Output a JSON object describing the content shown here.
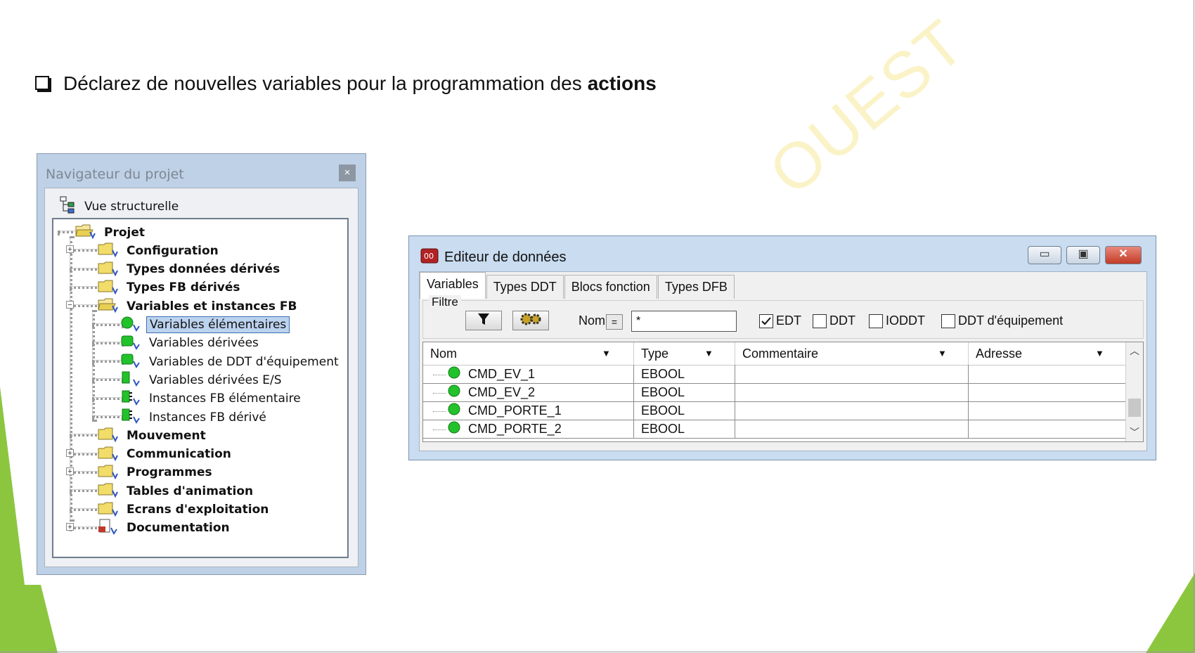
{
  "slide": {
    "bullet_text": "Déclarez de nouvelles variables pour la programmation des",
    "bullet_bold": "actions",
    "watermark": "OUEST",
    "accent_color": "#8cc63f"
  },
  "navigator": {
    "title": "Navigateur du projet",
    "close_label": "×",
    "view_label": "Vue structurelle",
    "items": [
      {
        "label": "Projet"
      },
      {
        "label": "Configuration"
      },
      {
        "label": "Types données dérivés"
      },
      {
        "label": "Types FB dérivés"
      },
      {
        "label": "Variables et instances FB"
      },
      {
        "label": "Variables élémentaires"
      },
      {
        "label": "Variables dérivées"
      },
      {
        "label": "Variables de DDT d'équipement"
      },
      {
        "label": "Variables dérivées E/S"
      },
      {
        "label": "Instances FB élémentaire"
      },
      {
        "label": "Instances FB dérivé"
      },
      {
        "label": "Mouvement"
      },
      {
        "label": "Communication"
      },
      {
        "label": "Programmes"
      },
      {
        "label": "Tables d'animation"
      },
      {
        "label": "Ecrans d'exploitation"
      },
      {
        "label": "Documentation"
      }
    ]
  },
  "editor": {
    "title": "Editeur de données",
    "tabs": [
      {
        "label": "Variables"
      },
      {
        "label": "Types DDT"
      },
      {
        "label": "Blocs fonction"
      },
      {
        "label": "Types DFB"
      }
    ],
    "filter": {
      "legend": "Filtre",
      "nom_label": "Nom",
      "eq_label": "=",
      "nom_value": "*",
      "checks": [
        {
          "label": "EDT",
          "checked": true
        },
        {
          "label": "DDT",
          "checked": false
        },
        {
          "label": "IODDT",
          "checked": false
        },
        {
          "label": "DDT d'équipement",
          "checked": false
        }
      ]
    },
    "columns": [
      "Nom",
      "Type",
      "Commentaire",
      "Adresse"
    ],
    "rows": [
      {
        "nom": "CMD_EV_1",
        "type": "EBOOL",
        "commentaire": "",
        "adresse": ""
      },
      {
        "nom": "CMD_EV_2",
        "type": "EBOOL",
        "commentaire": "",
        "adresse": ""
      },
      {
        "nom": "CMD_PORTE_1",
        "type": "EBOOL",
        "commentaire": "",
        "adresse": ""
      },
      {
        "nom": "CMD_PORTE_2",
        "type": "EBOOL",
        "commentaire": "",
        "adresse": ""
      }
    ]
  }
}
